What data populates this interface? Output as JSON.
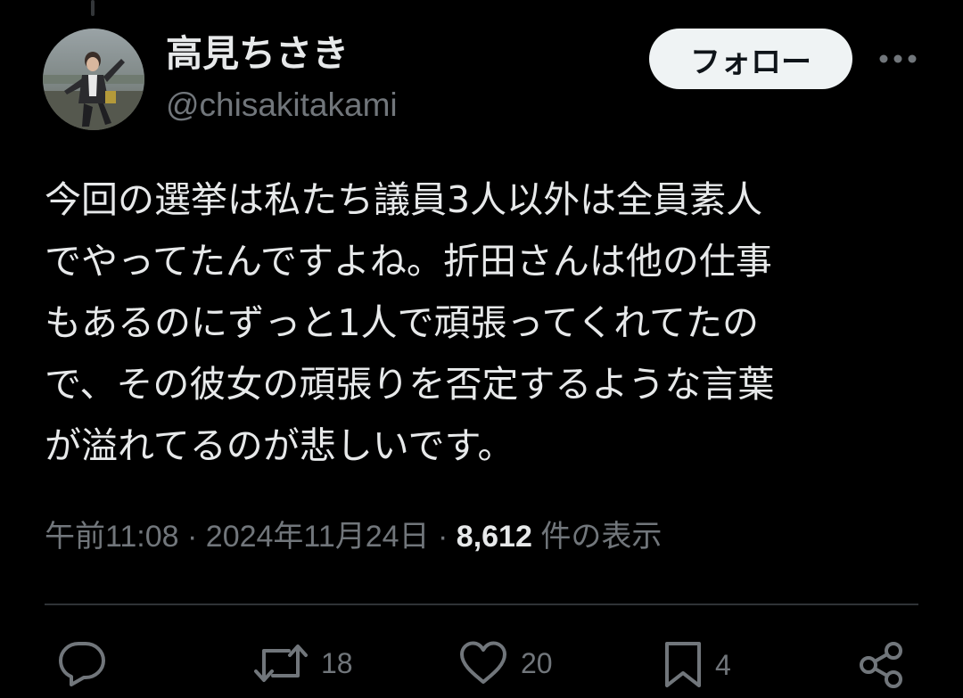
{
  "author": {
    "display_name": "高見ちさき",
    "handle": "@chisakitakami"
  },
  "follow_label": "フォロー",
  "tweet": {
    "lines": [
      "今回の選挙は私たち議員3人以外は全員素人",
      "でやってたんですよね。折田さんは他の仕事",
      "もあるのにずっと1人で頑張ってくれてたの",
      "で、その彼女の頑張りを否定するような言葉",
      "が溢れてるのが悲しいです。"
    ]
  },
  "meta": {
    "time": "午前11:08",
    "separator": "·",
    "date": "2024年11月24日",
    "views_count": "8,612",
    "views_label": "件の表示"
  },
  "actions": {
    "reply_icon": "reply-icon",
    "retweet_icon": "retweet-icon",
    "retweet_count": "18",
    "like_icon": "like-icon",
    "like_count": "20",
    "bookmark_icon": "bookmark-icon",
    "bookmark_count": "4",
    "share_icon": "share-icon"
  },
  "colors": {
    "background": "#000000",
    "text": "#e7e9ea",
    "secondary": "#71767b",
    "divider": "#2f3336",
    "follow_bg": "#eff3f4"
  }
}
